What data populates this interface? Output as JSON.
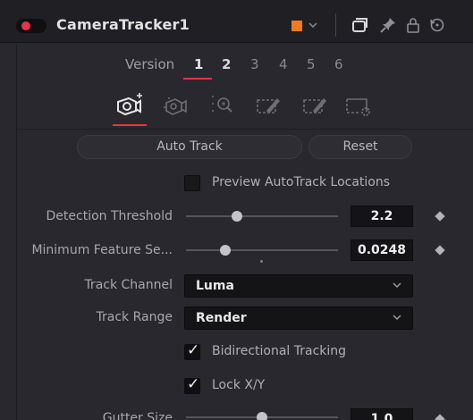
{
  "header": {
    "title": "CameraTracker1",
    "color_swatch": "#f07a1c",
    "icons": [
      "chevron-down-icon",
      "window-icon",
      "pin-icon",
      "lock-icon",
      "reset-icon"
    ]
  },
  "versions": {
    "label": "Version",
    "items": [
      "1",
      "2",
      "3",
      "4",
      "5",
      "6"
    ],
    "active": "1"
  },
  "tabs": [
    "track-tab-icon",
    "camera-tab-icon",
    "solve-tab-icon",
    "export-tab-icon",
    "options-tab-icon",
    "settings-tab-icon"
  ],
  "buttons": {
    "auto_track": "Auto Track",
    "reset": "Reset"
  },
  "preview": {
    "label": "Preview AutoTrack Locations",
    "checked": false
  },
  "detection_threshold": {
    "label": "Detection Threshold",
    "value": "2.2"
  },
  "min_feature_sep": {
    "label": "Minimum Feature Se...",
    "value": "0.0248"
  },
  "track_channel": {
    "label": "Track Channel",
    "value": "Luma"
  },
  "track_range": {
    "label": "Track Range",
    "value": "Render"
  },
  "bidirectional": {
    "label": "Bidirectional Tracking",
    "checked": true
  },
  "lock_xy": {
    "label": "Lock X/Y",
    "checked": true
  },
  "gutter_size": {
    "label": "Gutter Size",
    "value": "1.0"
  },
  "colors": {
    "accent": "#e2373f",
    "swatch": "#f07a1c"
  }
}
